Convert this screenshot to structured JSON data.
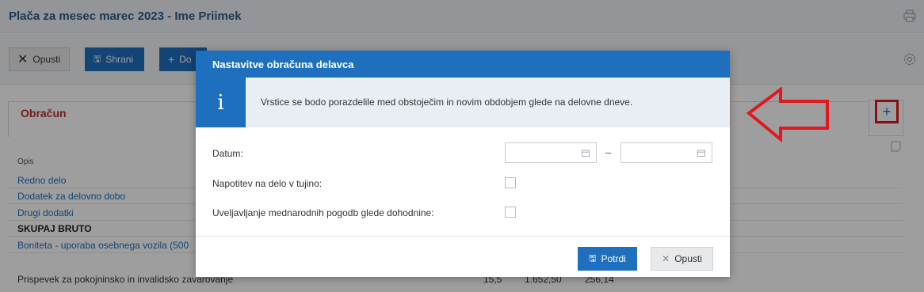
{
  "page": {
    "title": "Plača za mesec marec 2023 - Ime Priimek",
    "print_icon": "printer-icon",
    "settings_icon": "gear-icon"
  },
  "toolbar": {
    "cancel_label": "Opusti",
    "save_label": "Shrani",
    "add_label": "Do"
  },
  "section": {
    "title": "Obračun",
    "add_icon": "plus-icon"
  },
  "table": {
    "header": "Opis",
    "rows": [
      {
        "label": "Redno delo",
        "style": "link"
      },
      {
        "label": "Dodatek za delovno dobo",
        "style": "link"
      },
      {
        "label": "Drugi dodatki",
        "style": "link"
      },
      {
        "label": "SKUPAJ BRUTO",
        "style": "bold"
      },
      {
        "label": "Boniteta - uporaba osebnega vozila (500",
        "style": "link"
      },
      {
        "label": "Prispevek za pokojninsko in invalidsko zavarovanje",
        "style": "plain",
        "values": [
          "15,5",
          "1.652,50",
          "256,14"
        ]
      }
    ]
  },
  "modal": {
    "title": "Nastavitve obračuna delavca",
    "info_text": "Vrstice se bodo porazdelile med obstoječim in novim obdobjem glede na delovne dneve.",
    "info_icon": "i",
    "date_label": "Datum:",
    "date_separator": "–",
    "date_from": "",
    "date_to": "",
    "posting_label": "Napotitev na delo v tujino:",
    "treaty_label": "Uveljavljanje mednarodnih pogodb glede dohodnine:",
    "confirm_label": "Potrdi",
    "cancel_label": "Opusti"
  },
  "colors": {
    "accent": "#1f6fbf",
    "section_title": "#b8322c",
    "annotation": "#e0191e"
  }
}
